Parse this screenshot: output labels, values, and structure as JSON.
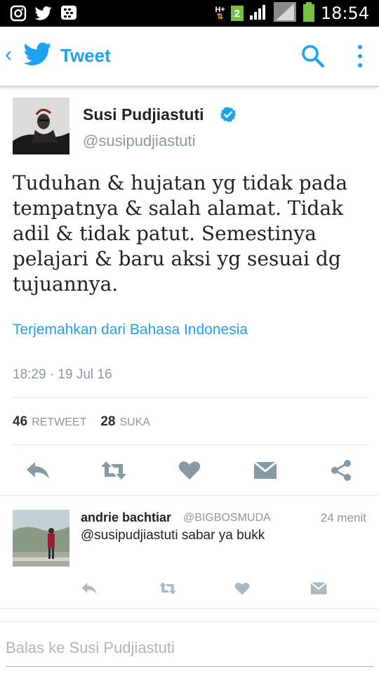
{
  "status_bar": {
    "time": "18:54",
    "network": "H+",
    "sim": "2",
    "icons": [
      "instagram-icon",
      "twitter-icon",
      "bbm-icon",
      "signal-icon",
      "battery-icon"
    ]
  },
  "app_bar": {
    "title": "Tweet",
    "icons": [
      "back-icon",
      "twitter-bird-icon",
      "search-icon",
      "more-icon"
    ],
    "accent_color": "#1da1f2"
  },
  "tweet": {
    "author_name": "Susi Pudjiastuti",
    "author_handle": "@susipudjiastuti",
    "text": "Tuduhan & hujatan yg tidak pada tempatnya & salah alamat. Tidak adil & tidak patut. Semestinya pelajari & baru aksi yg sesuai dg tujuannya.",
    "translate_link": "Terjemahkan dari Bahasa Indonesia",
    "timestamp": "18:29 · 19 Jul 16",
    "retweet_count": "46",
    "retweet_label": "RETWEET",
    "like_count": "28",
    "like_label": "SUKA",
    "actions": [
      "reply-icon",
      "retweet-icon",
      "like-icon",
      "message-icon",
      "share-icon"
    ]
  },
  "reply": {
    "name": "andrie bachtiar",
    "handle": "@BIGBOSMUDA",
    "time": "24 menit",
    "text": "@susipudjiastuti sabar ya bukk"
  },
  "compose": {
    "placeholder": "Balas ke Susi Pudjiastuti"
  }
}
